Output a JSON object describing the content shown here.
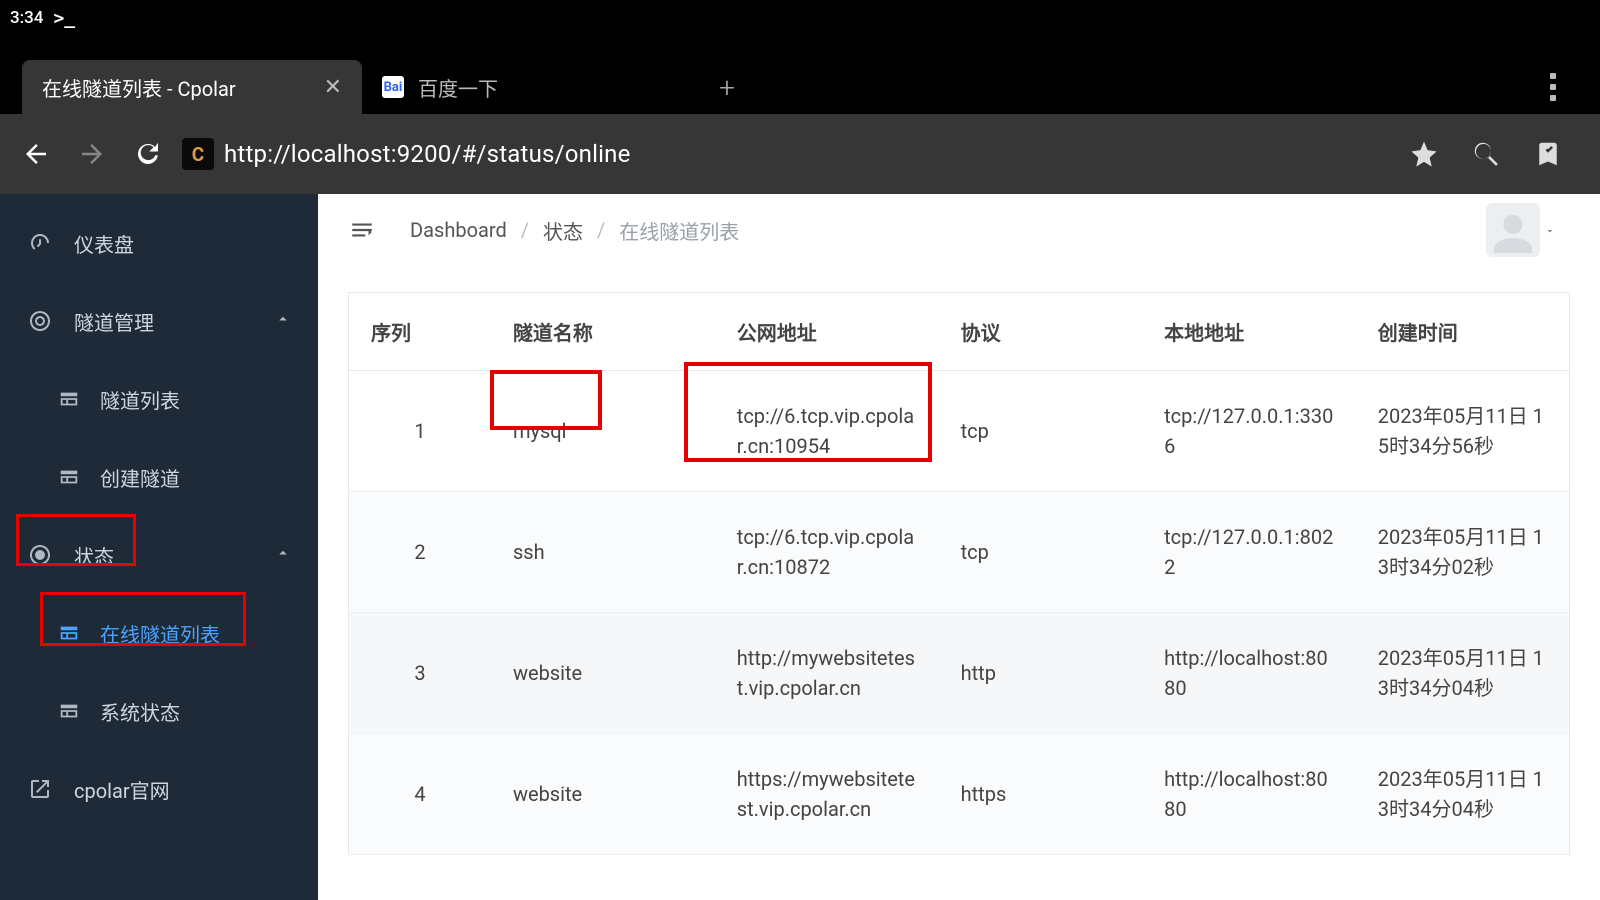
{
  "status_bar": {
    "time": "3:34",
    "prompt": ">_"
  },
  "tabs": {
    "active": {
      "title": "在线隧道列表 - Cpolar"
    },
    "other": {
      "title": "百度一下",
      "favicon_text": "Bai"
    },
    "site_icon_letter": "C"
  },
  "url": "http://localhost:9200/#/status/online",
  "sidebar": {
    "dashboard": "仪表盘",
    "tunnel_mgmt": "隧道管理",
    "tunnel_list": "隧道列表",
    "create_tunnel": "创建隧道",
    "status": "状态",
    "online_tunnels": "在线隧道列表",
    "system_status": "系统状态",
    "cpolar_site": "cpolar官网"
  },
  "breadcrumb": {
    "dashboard": "Dashboard",
    "status": "状态",
    "current": "在线隧道列表"
  },
  "table": {
    "headers": {
      "seq": "序列",
      "name": "隧道名称",
      "public": "公网地址",
      "protocol": "协议",
      "local": "本地地址",
      "created": "创建时间"
    },
    "rows": [
      {
        "seq": "1",
        "name": "mysql",
        "public": "tcp://6.tcp.vip.cpolar.cn:10954",
        "protocol": "tcp",
        "local": "tcp://127.0.0.1:3306",
        "created": "2023年05月11日 15时34分56秒"
      },
      {
        "seq": "2",
        "name": "ssh",
        "public": "tcp://6.tcp.vip.cpolar.cn:10872",
        "protocol": "tcp",
        "local": "tcp://127.0.0.1:8022",
        "created": "2023年05月11日 13时34分02秒"
      },
      {
        "seq": "3",
        "name": "website",
        "public": "http://mywebsitetest.vip.cpolar.cn",
        "protocol": "http",
        "local": "http://localhost:8080",
        "created": "2023年05月11日 13时34分04秒"
      },
      {
        "seq": "4",
        "name": "website",
        "public": "https://mywebsitetest.vip.cpolar.cn",
        "protocol": "https",
        "local": "http://localhost:8080",
        "created": "2023年05月11日 13时34分04秒"
      }
    ]
  }
}
